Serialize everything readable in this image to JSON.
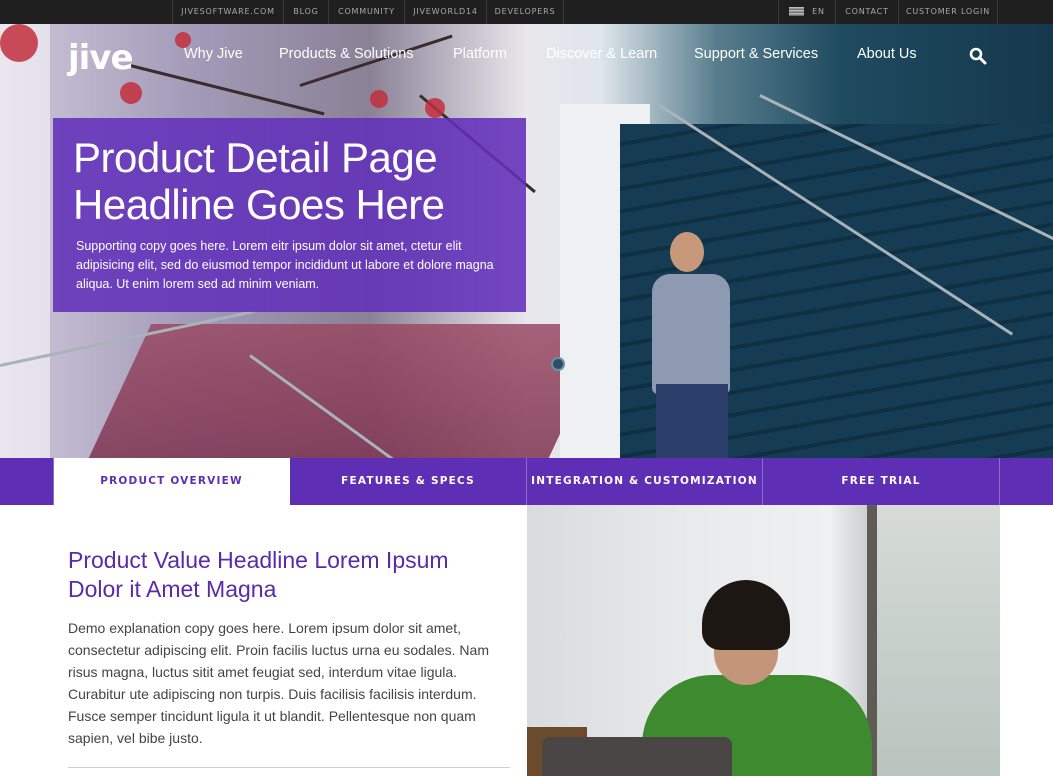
{
  "utility_nav": {
    "left_links": [
      "JIVESOFTWARE.COM",
      "BLOG",
      "COMMUNITY",
      "JIVEWORLD14",
      "DEVELOPERS"
    ],
    "language": "EN",
    "contact": "CONTACT",
    "customer_login": "CUSTOMER LOGIN"
  },
  "header": {
    "logo": "jive",
    "nav": [
      "Why Jive",
      "Products & Solutions",
      "Platform",
      "Discover & Learn",
      "Support & Services",
      "About Us"
    ]
  },
  "hero": {
    "title_line1": "Product Detail Page",
    "title_line2": "Headline Goes Here",
    "copy": "Supporting copy goes here. Lorem eitr ipsum dolor sit amet, ctetur elit adipisicing elit, sed do eiusmod tempor incididunt ut labore et dolore magna aliqua. Ut enim lorem sed ad minim veniam."
  },
  "tabs": [
    "PRODUCT OVERVIEW",
    "FEATURES & SPECS",
    "INTEGRATION & CUSTOMIZATION",
    "FREE TRIAL"
  ],
  "content": {
    "headline": "Product Value Headline Lorem Ipsum Dolor it Amet Magna",
    "copy": "Demo explanation copy goes here. Lorem ipsum dolor sit amet, consectetur adipiscing elit. Proin facilis luctus urna eu sodales. Nam risus magna, luctus sitit amet feugiat sed, interdum vitae ligula. Curabitur ute adipiscing non turpis. Duis facilisis facilisis interdum. Fusce semper tincidunt ligula it ut blandit. Pellentesque non quam sapien, vel bibe justo."
  },
  "colors": {
    "brand_purple": "#5e2fb4",
    "utility_bar": "#1f1f1f",
    "headline_purple": "#5a2aab"
  },
  "icons": {
    "search": "search-icon",
    "flag": "us-flag-icon"
  }
}
